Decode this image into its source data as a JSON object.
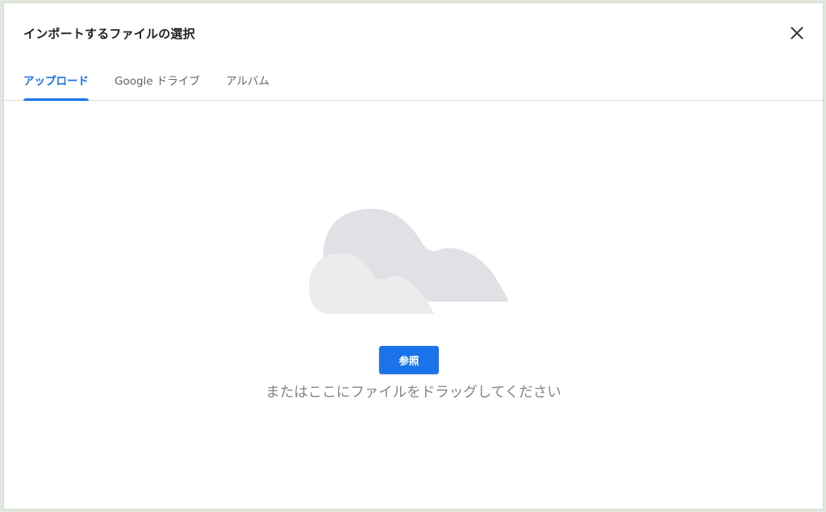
{
  "dialog": {
    "title": "インポートするファイルの選択",
    "close_icon": "close-icon"
  },
  "tabs": [
    {
      "label": "アップロード",
      "active": true
    },
    {
      "label": "Google ドライブ",
      "active": false
    },
    {
      "label": "アルバム",
      "active": false
    }
  ],
  "upload": {
    "illustration_icon": "cloud-icon",
    "browse_label": "参照",
    "drag_text": "またはここにファイルをドラッグしてください"
  },
  "colors": {
    "accent": "#1a73e8",
    "cloud_back": "#dfe1e5",
    "cloud_front": "#ececed"
  }
}
